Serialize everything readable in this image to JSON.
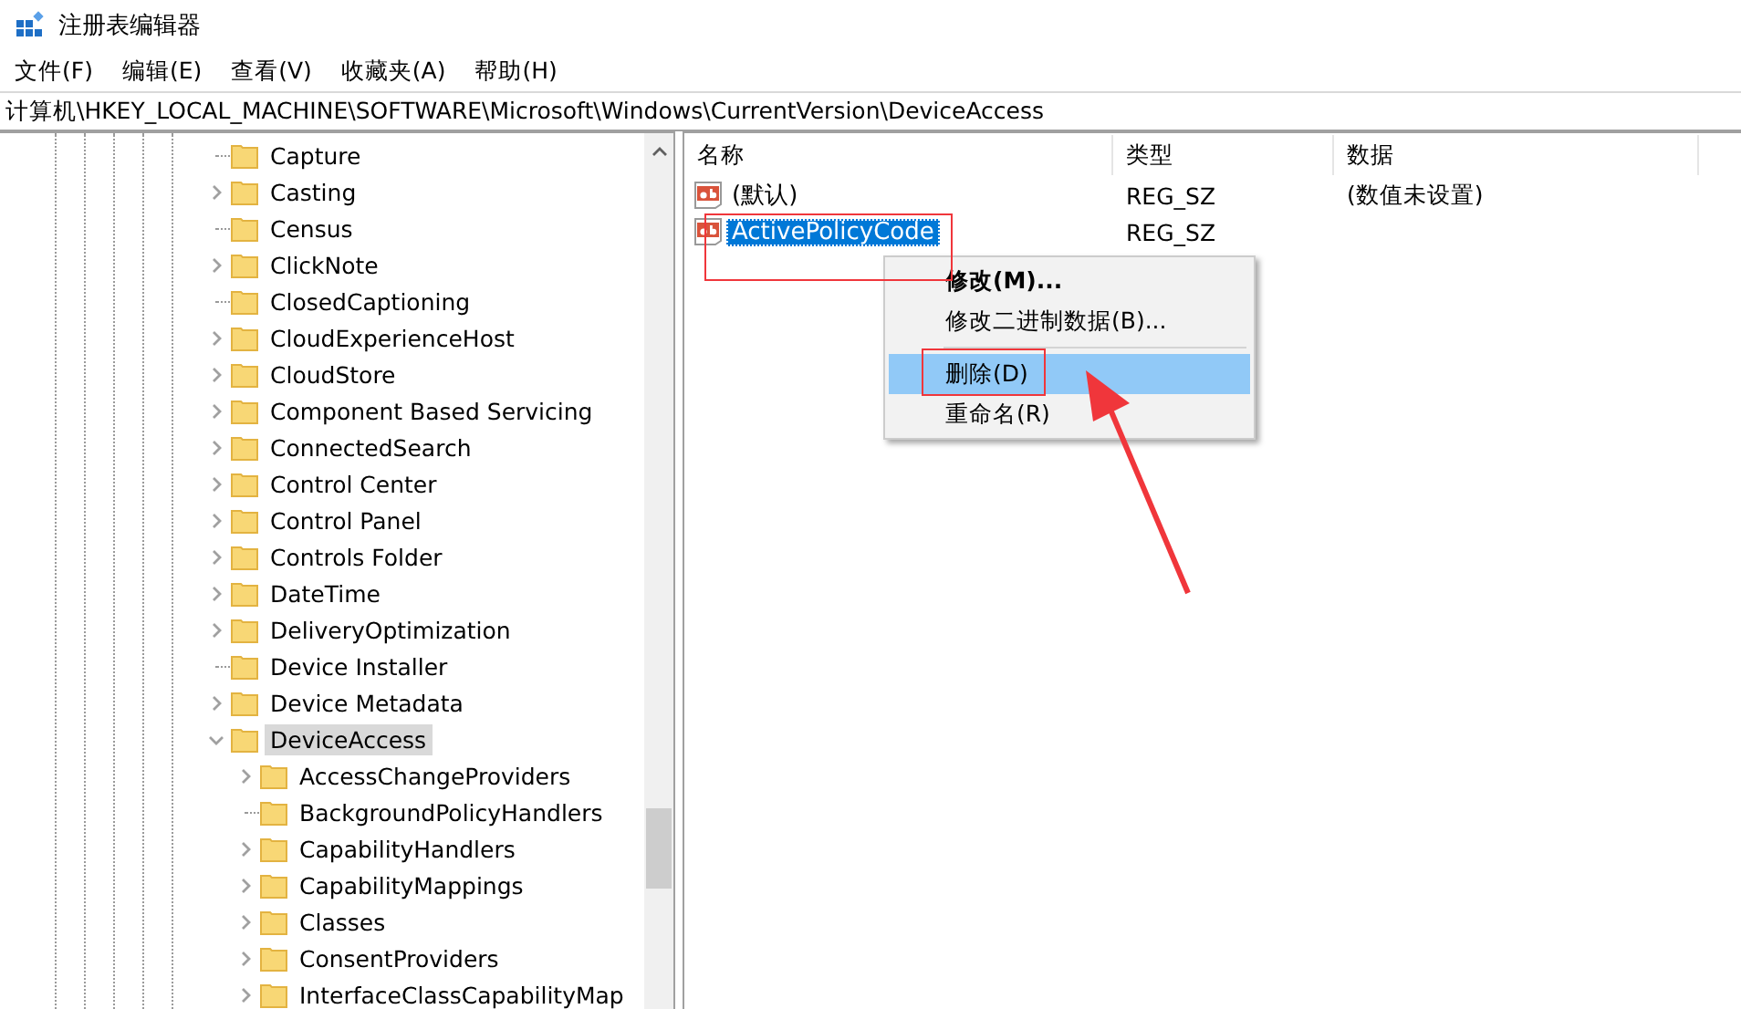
{
  "window": {
    "title": "注册表编辑器"
  },
  "menu_bar": [
    "文件(F)",
    "编辑(E)",
    "查看(V)",
    "收藏夹(A)",
    "帮助(H)"
  ],
  "address_bar": {
    "value": "计算机\\HKEY_LOCAL_MACHINE\\SOFTWARE\\Microsoft\\Windows\\CurrentVersion\\DeviceAccess"
  },
  "tree": [
    {
      "label": "Capture",
      "kind": "leaf",
      "selected": false
    },
    {
      "label": "Casting",
      "kind": "collapsed",
      "selected": false
    },
    {
      "label": "Census",
      "kind": "leaf",
      "selected": false
    },
    {
      "label": "ClickNote",
      "kind": "collapsed",
      "selected": false
    },
    {
      "label": "ClosedCaptioning",
      "kind": "leaf",
      "selected": false
    },
    {
      "label": "CloudExperienceHost",
      "kind": "collapsed",
      "selected": false
    },
    {
      "label": "CloudStore",
      "kind": "collapsed",
      "selected": false
    },
    {
      "label": "Component Based Servicing",
      "kind": "collapsed",
      "selected": false
    },
    {
      "label": "ConnectedSearch",
      "kind": "collapsed",
      "selected": false
    },
    {
      "label": "Control Center",
      "kind": "collapsed",
      "selected": false
    },
    {
      "label": "Control Panel",
      "kind": "collapsed",
      "selected": false
    },
    {
      "label": "Controls Folder",
      "kind": "collapsed",
      "selected": false
    },
    {
      "label": "DateTime",
      "kind": "collapsed",
      "selected": false
    },
    {
      "label": "DeliveryOptimization",
      "kind": "collapsed",
      "selected": false
    },
    {
      "label": "Device Installer",
      "kind": "leaf",
      "selected": false
    },
    {
      "label": "Device Metadata",
      "kind": "collapsed",
      "selected": false
    },
    {
      "label": "DeviceAccess",
      "kind": "expanded",
      "selected": true,
      "children": [
        {
          "label": "AccessChangeProviders",
          "kind": "collapsed",
          "selected": false
        },
        {
          "label": "BackgroundPolicyHandlers",
          "kind": "leaf",
          "selected": false
        },
        {
          "label": "CapabilityHandlers",
          "kind": "collapsed",
          "selected": false
        },
        {
          "label": "CapabilityMappings",
          "kind": "collapsed",
          "selected": false
        },
        {
          "label": "Classes",
          "kind": "collapsed",
          "selected": false
        },
        {
          "label": "ConsentProviders",
          "kind": "collapsed",
          "selected": false
        },
        {
          "label": "InterfaceClassCapabilityMap",
          "kind": "collapsed",
          "selected": false
        }
      ]
    }
  ],
  "values": {
    "columns": [
      "名称",
      "类型",
      "数据"
    ],
    "rows": [
      {
        "name": "(默认)",
        "type": "REG_SZ",
        "data": "(数值未设置)",
        "selected": false
      },
      {
        "name": "ActivePolicyCode",
        "type": "REG_SZ",
        "selected": true
      }
    ]
  },
  "context_menu": [
    {
      "kind": "item",
      "label": "修改(M)...",
      "bold": true,
      "highlighted": false
    },
    {
      "kind": "item",
      "label": "修改二进制数据(B)...",
      "bold": false,
      "highlighted": false
    },
    {
      "kind": "separator"
    },
    {
      "kind": "item",
      "label": "删除(D)",
      "bold": false,
      "highlighted": true
    },
    {
      "kind": "item",
      "label": "重命名(R)",
      "bold": false,
      "highlighted": false
    }
  ]
}
